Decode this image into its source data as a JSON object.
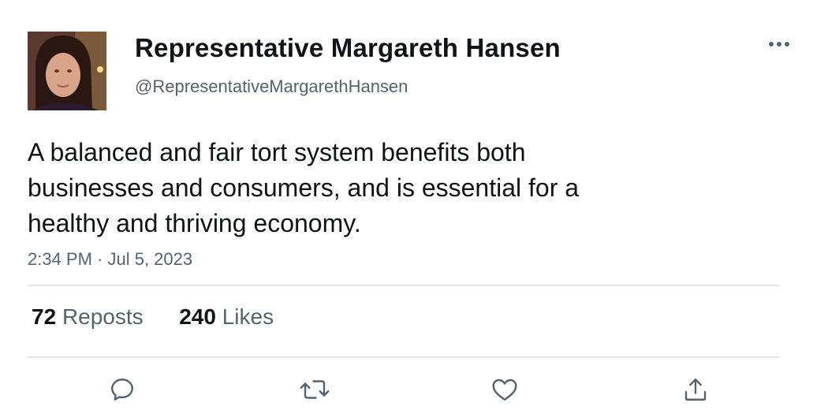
{
  "author": {
    "display_name": "Representative Margareth Hansen",
    "handle": "@RepresentativeMargarethHansen"
  },
  "tweet": {
    "text": "A balanced and fair tort system benefits both\nbusinesses and consumers, and is essential for a\nhealthy and thriving economy.",
    "timestamp": "2:34 PM · Jul 5, 2023"
  },
  "stats": {
    "reposts_count": "72",
    "reposts_label": "Reposts",
    "likes_count": "240",
    "likes_label": "Likes"
  },
  "actions": [
    {
      "name": "reply",
      "icon": "reply-icon"
    },
    {
      "name": "repost",
      "icon": "repost-icon"
    },
    {
      "name": "like",
      "icon": "heart-icon"
    },
    {
      "name": "share",
      "icon": "share-icon"
    }
  ],
  "colors": {
    "text_primary": "#0f1419",
    "text_secondary": "#536471",
    "divider": "#e1e5e8"
  }
}
